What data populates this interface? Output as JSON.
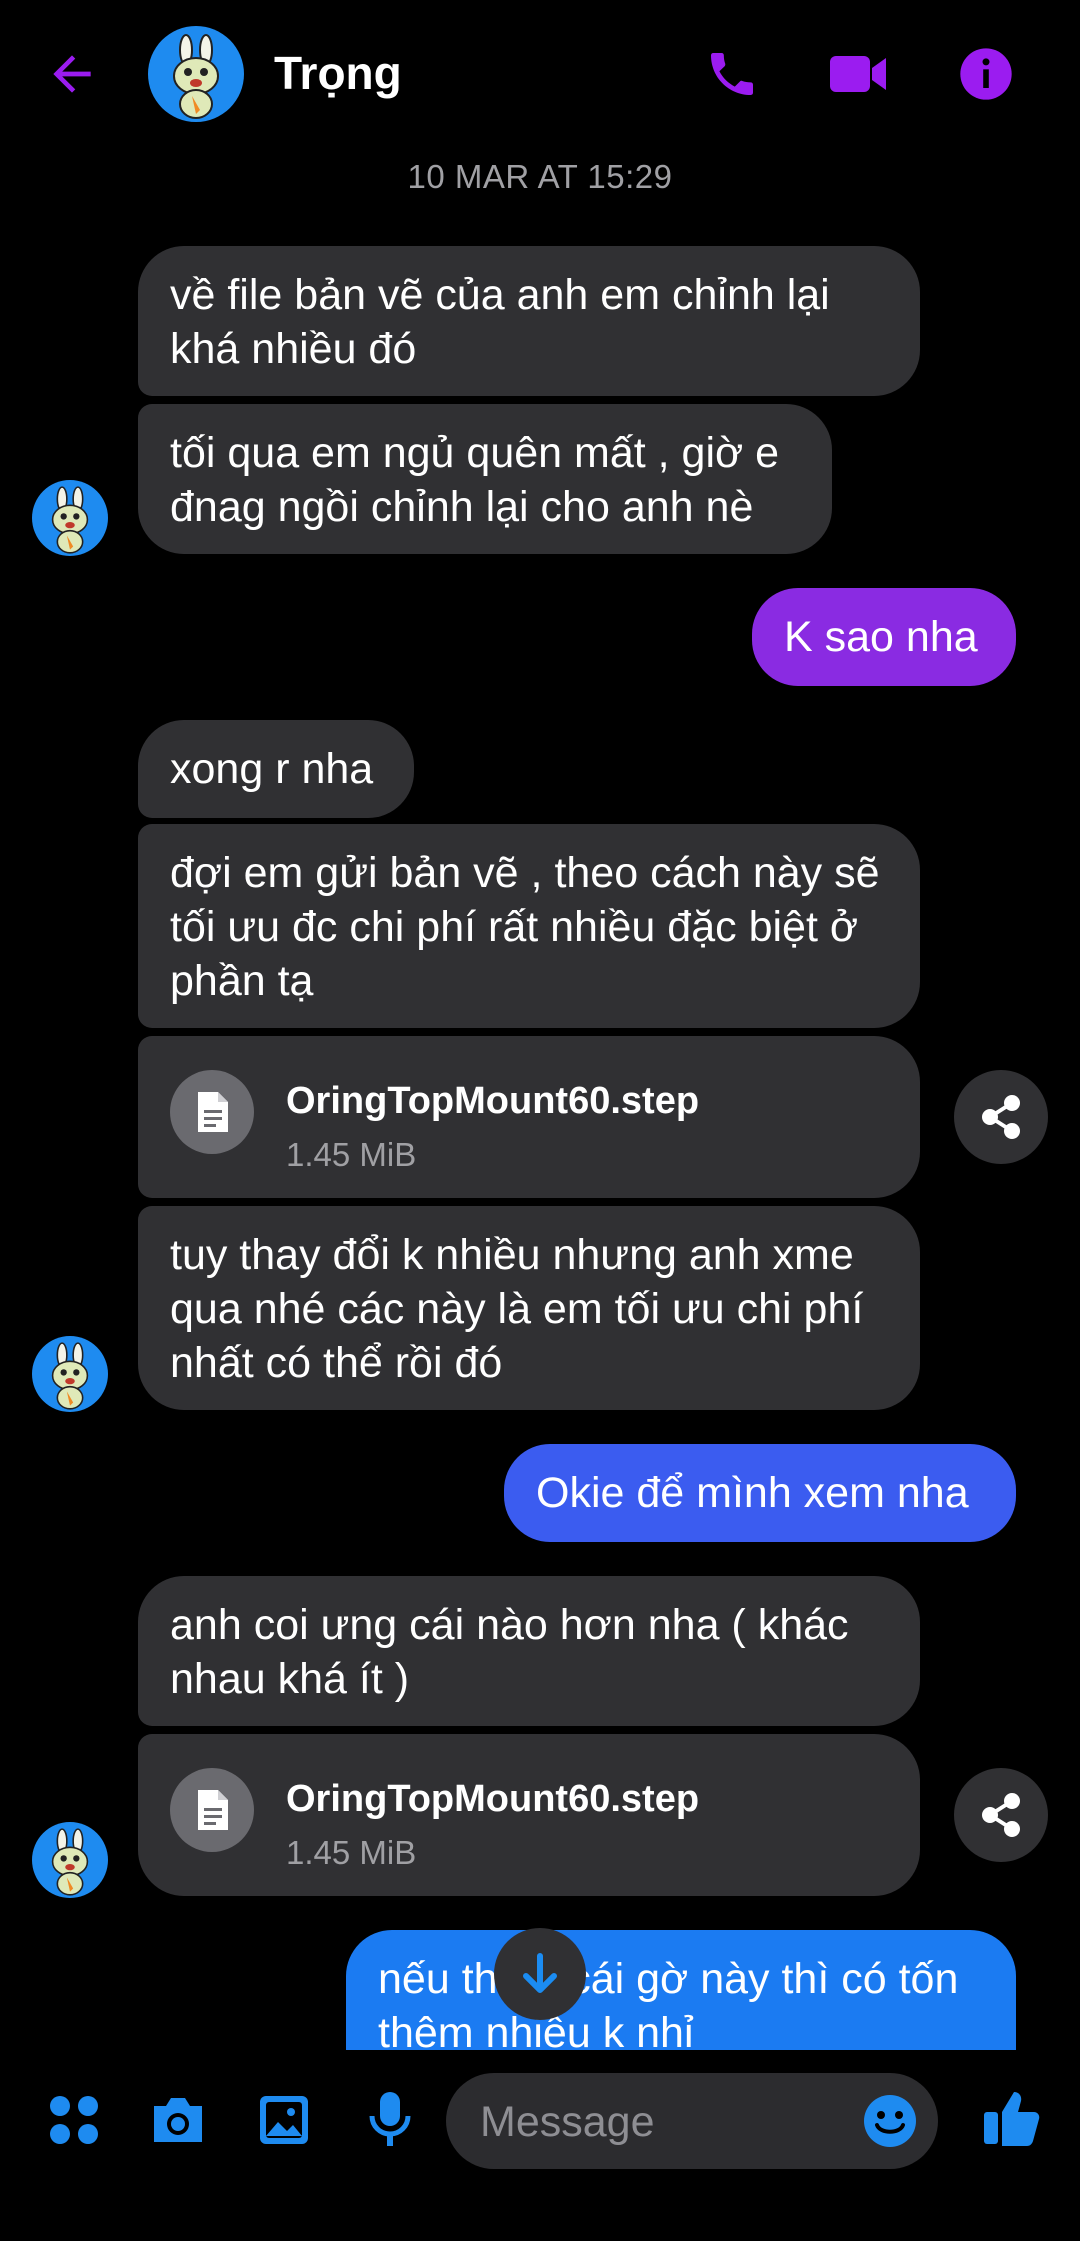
{
  "header": {
    "contact_name": "Trọng",
    "icons": [
      "back-arrow-icon",
      "phone-icon",
      "video-camera-icon",
      "info-icon"
    ]
  },
  "timestamp": "10 MAR AT 15:29",
  "messages": [
    {
      "text": "về file bản vẽ của anh em chỉnh lại khá nhiều đó"
    },
    {
      "text": "tối qua em ngủ quên mất , giờ e đnag ngồi chỉnh lại cho anh nè"
    },
    {
      "text": "K sao nha"
    },
    {
      "text": "xong r nha"
    },
    {
      "text": "đợi em gửi bản vẽ , theo cách này sẽ tối ưu đc chi phí rất nhiều đặc biệt ở phần tạ"
    },
    {
      "file_name": "OringTopMount60.step",
      "file_size": "1.45 MiB"
    },
    {
      "text": "tuy thay đổi k nhiều nhưng anh xme qua nhé các này là em tối ưu chi phí nhất có thể rồi đó"
    },
    {
      "text": "Okie để mình xem nha"
    },
    {
      "text": "anh coi ưng cái nào hơn  nha ( khác nhau khá ít )"
    },
    {
      "file_name": "OringTopMount60.step",
      "file_size": "1.45 MiB"
    },
    {
      "text": "nếu thêm cái gờ này thì có tốn thêm nhiều k nhỉ"
    }
  ],
  "composer": {
    "placeholder": "Message"
  },
  "colors": {
    "accent_purple": "#9b1cf0",
    "bubble_purple": "#8a2be2",
    "bubble_indigo": "#3b5cf0",
    "bubble_blue": "#1b7bf2",
    "incoming_bubble": "#303033",
    "toolbar_blue": "#1e8bf0"
  }
}
